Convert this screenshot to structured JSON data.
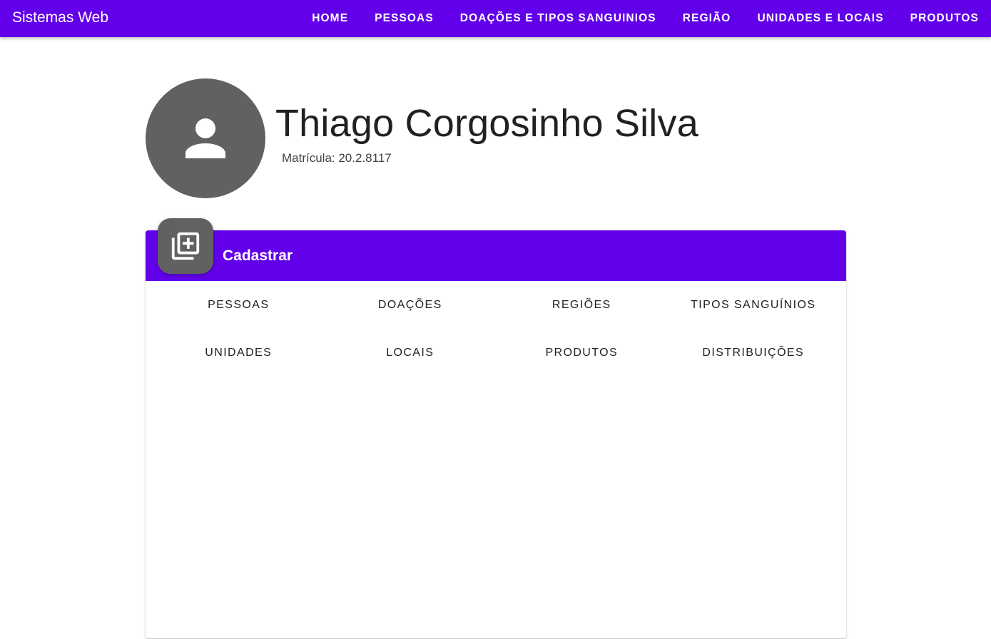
{
  "app": {
    "title": "Sistemas Web",
    "accent_color": "#6200ea"
  },
  "nav": {
    "items": [
      {
        "label": "HOME"
      },
      {
        "label": "PESSOAS"
      },
      {
        "label": "DOAÇÕES E TIPOS SANGUINIOS"
      },
      {
        "label": "REGIÃO"
      },
      {
        "label": "UNIDADES E LOCAIS"
      },
      {
        "label": "PRODUTOS"
      }
    ]
  },
  "profile": {
    "avatar_icon": "account-icon",
    "name": "Thiago Corgosinho Silva",
    "matricula": "Matrícula: 20.2.8117"
  },
  "card": {
    "icon": "library-add-icon",
    "title": "Cadastrar",
    "buttons": [
      {
        "label": "PESSOAS"
      },
      {
        "label": "DOAÇÕES"
      },
      {
        "label": "REGIÕES"
      },
      {
        "label": "TIPOS SANGUÍNIOS"
      },
      {
        "label": "UNIDADES"
      },
      {
        "label": "LOCAIS"
      },
      {
        "label": "PRODUTOS"
      },
      {
        "label": "DISTRIBUIÇÕES"
      }
    ]
  }
}
